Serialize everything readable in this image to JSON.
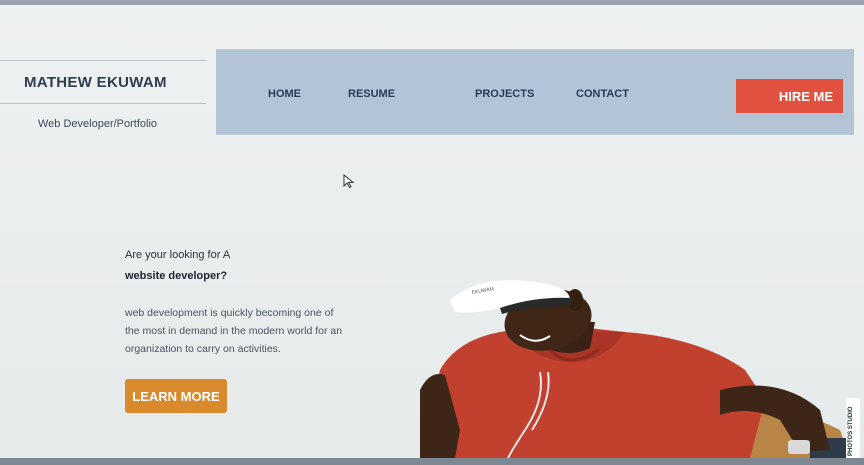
{
  "brand": {
    "name": "MATHEW EKUWAM",
    "tagline": "Web Developer/Portfolio"
  },
  "nav": {
    "items": [
      {
        "label": "HOME"
      },
      {
        "label": "RESUME"
      },
      {
        "label": "PROJECTS"
      },
      {
        "label": "CONTACT"
      }
    ],
    "cta_label": "HIRE ME"
  },
  "hero": {
    "line1": "Are your looking for A",
    "line2": "website developer?",
    "description_lines": [
      "web development is quickly becoming one of",
      "the most in demand in the modern world for an",
      "organization to carry on activities."
    ],
    "button_label": "LEARN MORE",
    "cap_text": "EKUWAM",
    "watermark_text": "PHOTOS STUDIO"
  },
  "colors": {
    "navbar_bg": "#b2c4d6",
    "hire_button": "#e2503f",
    "learn_button": "#d98a2c",
    "shirt": "#c2412e"
  },
  "icons": {
    "pointer": "mouse-cursor-icon"
  }
}
